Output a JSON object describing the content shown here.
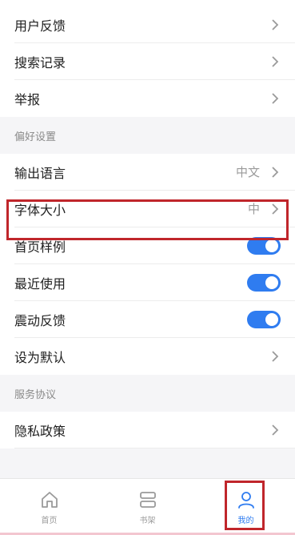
{
  "top_group": [
    {
      "label": "用户反馈"
    },
    {
      "label": "搜索记录"
    },
    {
      "label": "举报"
    }
  ],
  "pref_section": {
    "title": "偏好设置",
    "items": [
      {
        "label": "输出语言",
        "value": "中文",
        "type": "chevron"
      },
      {
        "label": "字体大小",
        "value": "中",
        "type": "chevron"
      },
      {
        "label": "首页样例",
        "type": "toggle",
        "on": true
      },
      {
        "label": "最近使用",
        "type": "toggle",
        "on": true
      },
      {
        "label": "震动反馈",
        "type": "toggle",
        "on": true
      },
      {
        "label": "设为默认",
        "type": "chevron"
      }
    ]
  },
  "service_section": {
    "title": "服务协议",
    "items": [
      {
        "label": "隐私政策",
        "type": "chevron"
      }
    ]
  },
  "tabbar": {
    "tabs": [
      {
        "label": "首页",
        "icon": "home-icon"
      },
      {
        "label": "书架",
        "icon": "bookshelf-icon"
      },
      {
        "label": "我的",
        "icon": "profile-icon",
        "active": true
      }
    ]
  },
  "colors": {
    "accent": "#2f7cf0",
    "highlight": "#c0262b"
  }
}
